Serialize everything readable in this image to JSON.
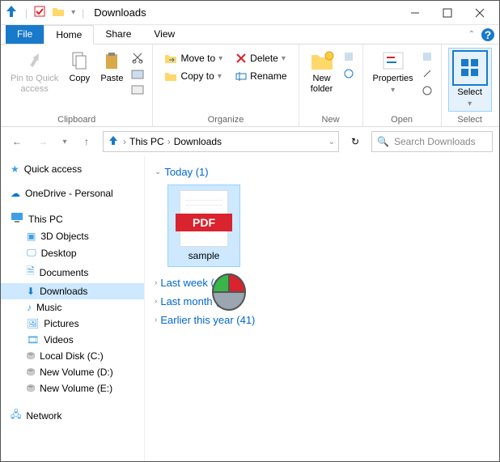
{
  "window": {
    "title": "Downloads"
  },
  "tabs": {
    "file": "File",
    "home": "Home",
    "share": "Share",
    "view": "View"
  },
  "ribbon": {
    "clipboard": {
      "label": "Clipboard",
      "pin": "Pin to Quick\naccess",
      "copy": "Copy",
      "paste": "Paste"
    },
    "organize": {
      "label": "Organize",
      "moveto": "Move to",
      "copyto": "Copy to",
      "delete": "Delete",
      "rename": "Rename"
    },
    "new": {
      "label": "New",
      "newfolder": "New\nfolder"
    },
    "open": {
      "label": "Open",
      "properties": "Properties"
    },
    "select": {
      "label": "Select",
      "select": "Select"
    }
  },
  "breadcrumb": {
    "thispc": "This PC",
    "downloads": "Downloads"
  },
  "search": {
    "placeholder": "Search Downloads"
  },
  "sidebar": {
    "quick": "Quick access",
    "onedrive": "OneDrive - Personal",
    "thispc": "This PC",
    "obj3d": "3D Objects",
    "desktop": "Desktop",
    "documents": "Documents",
    "downloads": "Downloads",
    "music": "Music",
    "pictures": "Pictures",
    "videos": "Videos",
    "localc": "Local Disk (C:)",
    "vold": "New Volume (D:)",
    "vole": "New Volume (E:)",
    "network": "Network"
  },
  "content": {
    "today": "Today (1)",
    "file": {
      "name": "sample",
      "badge": "PDF"
    },
    "lastweek": "Last week (1)",
    "lastmonth": "Last month (10)",
    "earlier": "Earlier this year (41)"
  }
}
